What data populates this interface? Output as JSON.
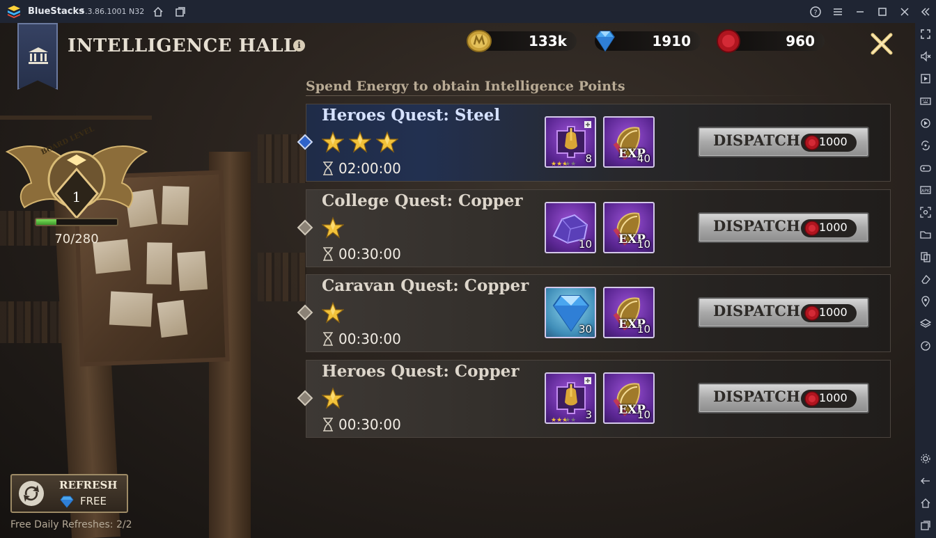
{
  "window": {
    "app_name": "BlueStacks",
    "version": "5.3.86.1001 N32"
  },
  "header": {
    "title": "INTELLIGENCE HALL",
    "info": "i"
  },
  "resources": [
    {
      "name": "gold",
      "value": "133k"
    },
    {
      "name": "diamond",
      "value": "1910"
    },
    {
      "name": "energy",
      "value": "960"
    }
  ],
  "board": {
    "label": "BOARD LEVEL",
    "level": "1",
    "progress_text": "70/280",
    "progress_fraction": 0.25
  },
  "subtitle": "Spend Energy to obtain Intelligence Points",
  "quests": [
    {
      "title": "Heroes Quest: Steel",
      "stars": 3,
      "time": "02:00:00",
      "selected": true,
      "rewards": [
        {
          "icon": "hero-fragment-icon",
          "count": "8",
          "style": "purple"
        },
        {
          "icon": "exp-scroll-icon",
          "count": "40",
          "style": "purple"
        }
      ],
      "dispatch": "DISPATCH",
      "cost": "1000"
    },
    {
      "title": "College Quest: Copper",
      "stars": 1,
      "time": "00:30:00",
      "selected": false,
      "rewards": [
        {
          "icon": "ore-icon",
          "count": "10",
          "style": "purple"
        },
        {
          "icon": "exp-scroll-icon",
          "count": "10",
          "style": "purple"
        }
      ],
      "dispatch": "DISPATCH",
      "cost": "1000"
    },
    {
      "title": "Caravan Quest: Copper",
      "stars": 1,
      "time": "00:30:00",
      "selected": false,
      "rewards": [
        {
          "icon": "diamond-icon",
          "count": "30",
          "style": "blue"
        },
        {
          "icon": "exp-scroll-icon",
          "count": "10",
          "style": "purple"
        }
      ],
      "dispatch": "DISPATCH",
      "cost": "1000"
    },
    {
      "title": "Heroes Quest: Copper",
      "stars": 1,
      "time": "00:30:00",
      "selected": false,
      "rewards": [
        {
          "icon": "hero-fragment-icon",
          "count": "3",
          "style": "purple"
        },
        {
          "icon": "exp-scroll-icon",
          "count": "10",
          "style": "purple"
        }
      ],
      "dispatch": "DISPATCH",
      "cost": "1000"
    }
  ],
  "exp_label": "EXP",
  "refresh": {
    "label": "REFRESH",
    "cost": "FREE",
    "note": "Free Daily Refreshes: 2/2"
  },
  "colors": {
    "titlebar": "#1f2533",
    "selected_quest": "#223050",
    "progress_green": "#5cc23e",
    "energy_red": "#c41b2a"
  }
}
